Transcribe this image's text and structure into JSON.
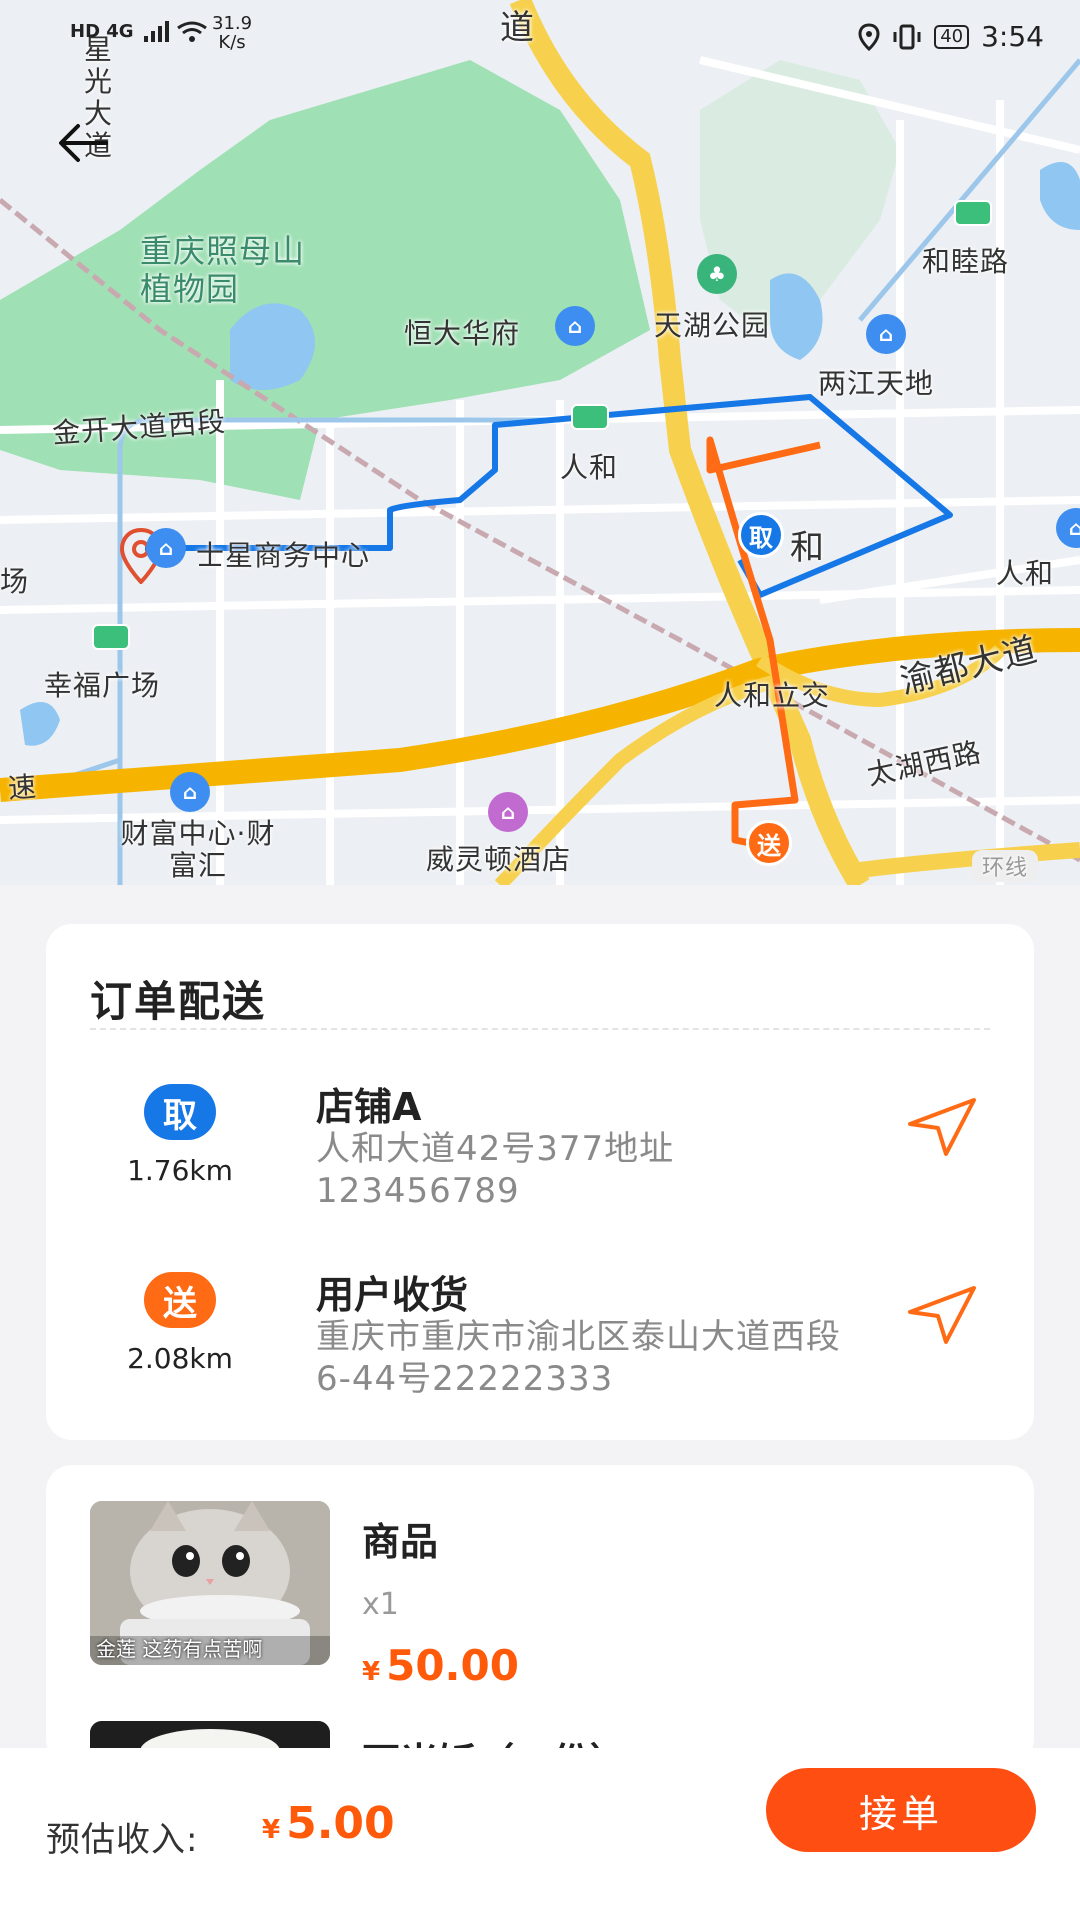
{
  "status_bar": {
    "network": "HD 4G",
    "speed_value": "31.9",
    "speed_unit": "K/s",
    "battery": "40",
    "time": "3:54"
  },
  "map": {
    "labels": {
      "top_road": "道",
      "xingguang": "星光大道",
      "garden": "重庆照母山植物园",
      "hengda": "恒大华府",
      "tianhu": "天湖公园",
      "hemulu": "和睦路",
      "liangjiang": "两江天地",
      "jinkai": "金开大道西段",
      "renhe_station": "人和",
      "tuxing": "士星商务中心",
      "renhe_district": "和",
      "renhe_right": "人和",
      "xingfu": "幸福广场",
      "renhe_interchange": "人和立交",
      "yudu": "渝都大道",
      "taihu": "太湖西路",
      "gaosu": "速",
      "caifu": "财富中心·财富汇",
      "wellington": "威灵顿酒店",
      "ring": "环线",
      "chang": "场"
    },
    "pickup_marker": "取",
    "delivery_marker": "送"
  },
  "order": {
    "title": "订单配送",
    "pickup": {
      "badge": "取",
      "distance": "1.76km",
      "name": "店铺A",
      "address": "人和大道42号377地址 123456789",
      "color": "#1677e6"
    },
    "delivery": {
      "badge": "送",
      "distance": "2.08km",
      "name": "用户收货",
      "address": "重庆市重庆市渝北区泰山大道西段6-44号22222333",
      "color": "#ff6a14"
    }
  },
  "products": [
    {
      "name": "商品",
      "qty": "x1",
      "currency": "¥",
      "price": "50.00",
      "image_caption": "金莲 这药有点苦啊"
    },
    {
      "name": "两米饭（一份）"
    }
  ],
  "footer": {
    "income_label": "预估收入:",
    "currency": "¥",
    "income": "5.00",
    "accept_label": "接单",
    "accent": "#ff4e12"
  }
}
